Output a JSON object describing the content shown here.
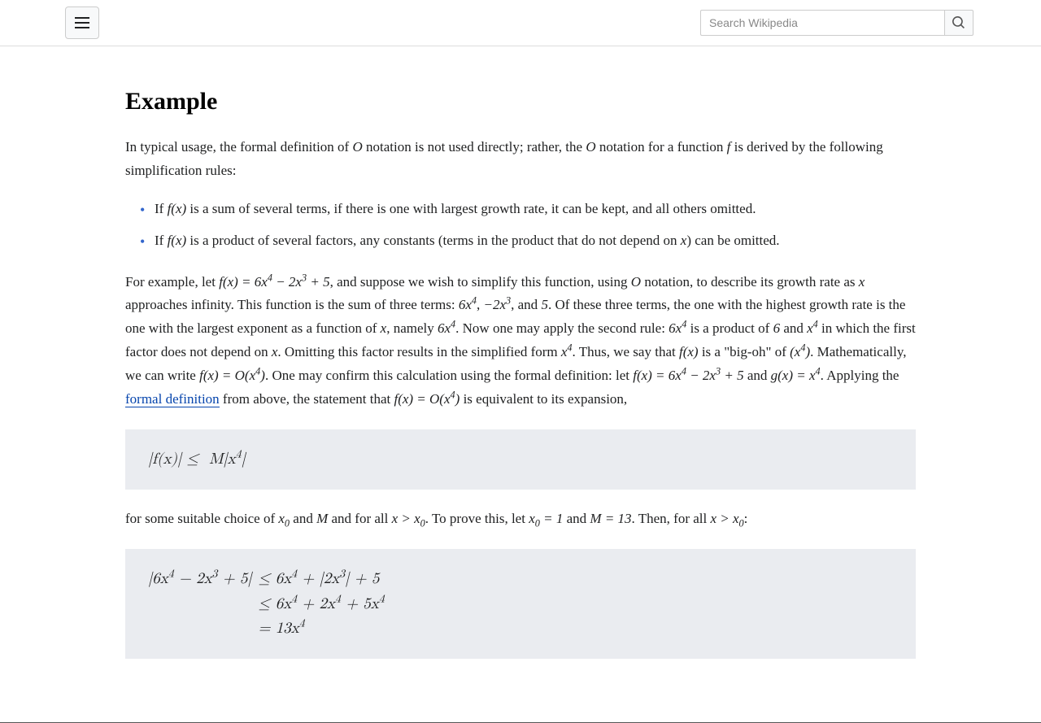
{
  "search": {
    "placeholder": "Search Wikipedia"
  },
  "section": {
    "title": "Example"
  },
  "p1": {
    "a": "In typical usage, the formal definition of ",
    "b": " notation is not used directly; rather, the ",
    "c": " notation for a function ",
    "d": " is derived by the following simplification rules:"
  },
  "rules": {
    "r1a": "If ",
    "r1b": " is a sum of several terms, if there is one with largest growth rate, it can be kept, and all others omitted.",
    "r2a": "If ",
    "r2b": " is a product of several factors, any constants (terms in the product that do not depend on ",
    "r2c": ") can be omitted."
  },
  "p2": {
    "a": "For example, let ",
    "b": ", and suppose we wish to simplify this function, using ",
    "c": " notation, to describe its growth rate as ",
    "d": " approaches infinity. This function is the sum of three terms: ",
    "e": ", and ",
    "f": ". Of these three terms, the one with the highest growth rate is the one with the largest exponent as a function of ",
    "g": ", namely ",
    "h": ". Now one may apply the second rule: ",
    "i": " is a product of ",
    "j": " and ",
    "k": " in which the first factor does not depend on ",
    "l": ". Omitting this factor results in the simplified form ",
    "m": ". Thus, we say that ",
    "n": " is a \"big-oh\" of ",
    "o": ". Mathematically, we can write ",
    "p": ". One may confirm this calculation using the formal definition: let ",
    "q": " and ",
    "r": ". Applying the ",
    "link": "formal definition",
    "s": " from above, the statement that ",
    "t": " is equivalent to its expansion,"
  },
  "math": {
    "O": "O",
    "f": "f",
    "x": "x",
    "g": "g",
    "M": "M",
    "fx": "f(x)",
    "gx": "g(x)",
    "fx_full": "f(x) = 6x⁴ − 2x³ + 5",
    "t6x4": "6x⁴",
    "tn2x3": "−2x³",
    "t5": "5",
    "t6": "6",
    "tx4": "x⁴",
    "paren_x4": "(x⁴)",
    "fx_Ox4": "f(x) = O(x⁴)",
    "fx_eq": "f(x) = 6x⁴ − 2x³ + 5",
    "gx_eq": "g(x) = x⁴",
    "x0": "x₀",
    "x0_eq1": "x₀ = 1",
    "M_eq13": "M = 13",
    "x_gt_x0": "x > x₀"
  },
  "eq1": "|f(x)| ≤  M|x⁴|",
  "p3": {
    "a": "for some suitable choice of ",
    "b": " and ",
    "c": " and for all ",
    "d": ". To prove this, let ",
    "e": " and ",
    "f": ". Then, for all ",
    "g": ":"
  },
  "eq2": {
    "l1l": "|6x⁴ − 2x³ + 5|",
    "l1r": " ≤ 6x⁴ + |2x³| + 5",
    "l2r": " ≤ 6x⁴ + 2x⁴ + 5x⁴",
    "l3r": " = 13x⁴"
  }
}
